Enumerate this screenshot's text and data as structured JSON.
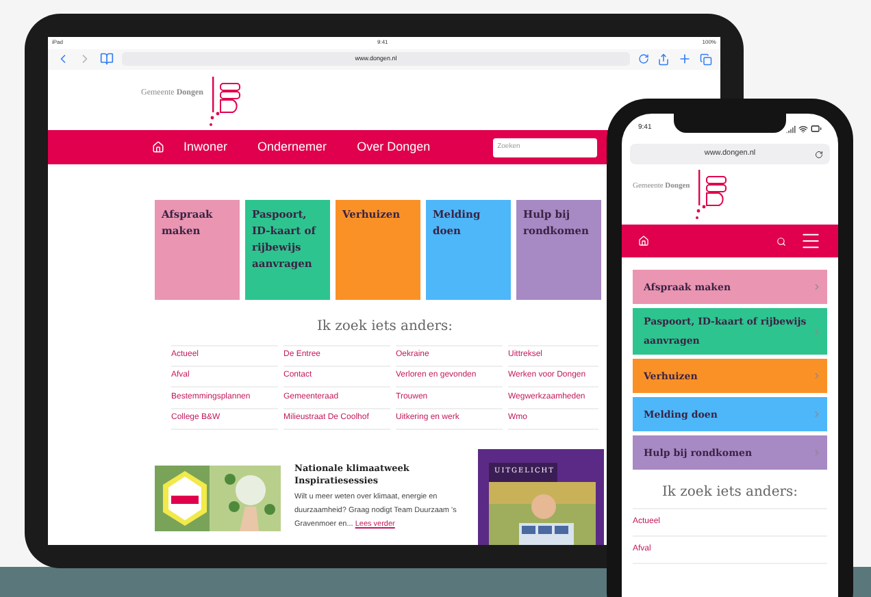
{
  "tablet": {
    "status_bar": {
      "device": "iPad",
      "time": "9:41",
      "battery": "100%"
    },
    "address_bar": {
      "url": "www.dongen.nl"
    },
    "logo": {
      "text": "Gemeente **Dongen**"
    },
    "nav": {
      "items": [
        "Inwoner",
        "Ondernemer",
        "Over Dongen"
      ],
      "search": {
        "placeholder": "Zoeken"
      }
    },
    "tiles": [
      {
        "label": "Afspraak maken",
        "color": "#ea95b1"
      },
      {
        "label": "Paspoort, ID-kaart of rijbewijs aanvragen",
        "color": "#2ec48f"
      },
      {
        "label": "Verhuizen",
        "color": "#fa9127"
      },
      {
        "label": "Melding doen",
        "color": "#4db7f9"
      },
      {
        "label": "Hulp bij rondkomen",
        "color": "#a789c4"
      }
    ],
    "heading": "Ik zoek iets anders:",
    "links": [
      "Actueel",
      "De Entree",
      "Oekraine",
      "Uittreksel",
      "Afval",
      "Contact",
      "Verloren en gevonden",
      "Werken voor Dongen",
      "Bestemmingsplannen",
      "Gemeenteraad",
      "Trouwen",
      "Wegwerkzaamheden",
      "College B&W",
      "Milieustraat De Coolhof",
      "Uitkering en werk",
      "Wmo"
    ],
    "news": {
      "title": "Nationale klimaatweek Inspiratiesessies",
      "body": "Wilt u meer weten over klimaat, energie en duurzaamheid? Graag nodigt Team Duurzaam 's Gravenmoer en...",
      "link": "Lees verder"
    },
    "featured": {
      "label": "UITGELICHT"
    }
  },
  "phone": {
    "status_bar": {
      "time": "9:41"
    },
    "address_bar": {
      "url": "www.dongen.nl"
    },
    "logo": {
      "text": "Gemeente **Dongen**"
    },
    "tiles": [
      {
        "label": "Afspraak maken",
        "color": "#ea95b1"
      },
      {
        "label": "Paspoort, ID-kaart of rijbewijs aanvragen",
        "color": "#2ec48f"
      },
      {
        "label": "Verhuizen",
        "color": "#fa9127"
      },
      {
        "label": "Melding doen",
        "color": "#4db7f9"
      },
      {
        "label": "Hulp bij rondkomen",
        "color": "#a789c4"
      }
    ],
    "heading": "Ik zoek iets anders:",
    "links": [
      "Actueel",
      "Afval"
    ]
  }
}
